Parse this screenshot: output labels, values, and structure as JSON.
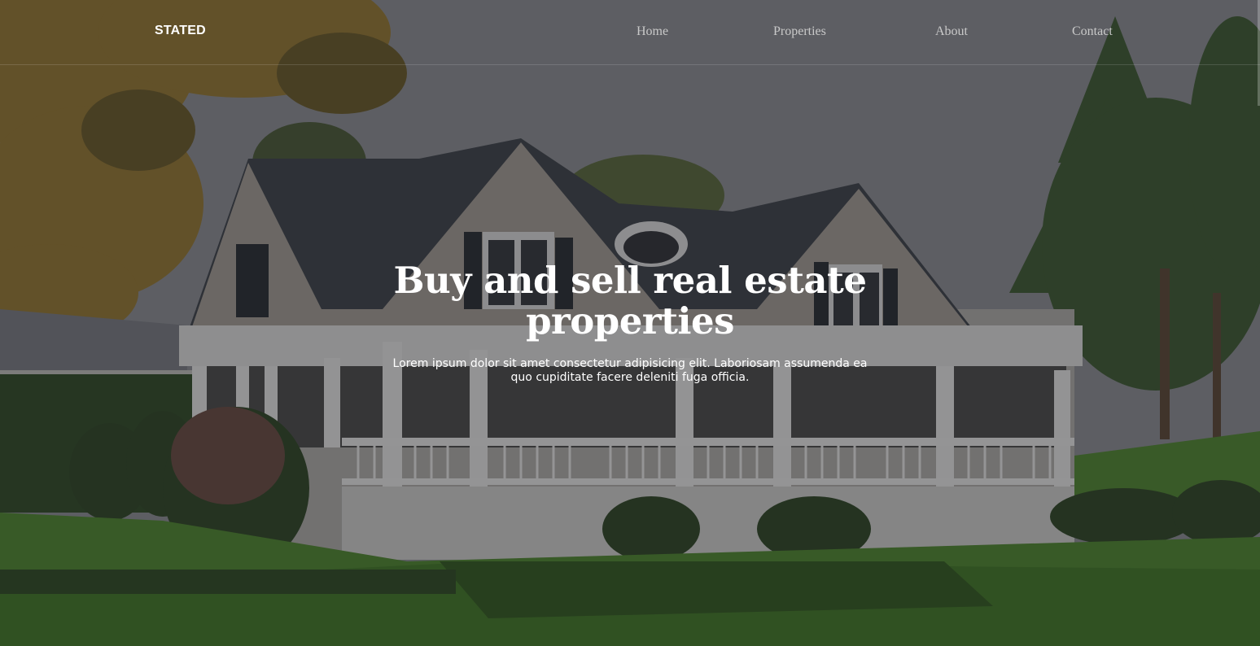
{
  "nav": {
    "brand": "STATED",
    "links": [
      "Home",
      "Properties",
      "About",
      "Contact"
    ]
  },
  "hero": {
    "headline": "Buy and sell real estate properties",
    "subtext": "Lorem ipsum dolor sit amet consectetur adipisicing elit. Laboriosam assumenda ea quo cupiditate facere deleniti fuga officia."
  },
  "colors": {
    "overlay": "#1e1e24",
    "text": "#ffffff",
    "nav_link": "#c9c9c9",
    "lawn": "#3f7a26",
    "sky": "#8e9096"
  }
}
